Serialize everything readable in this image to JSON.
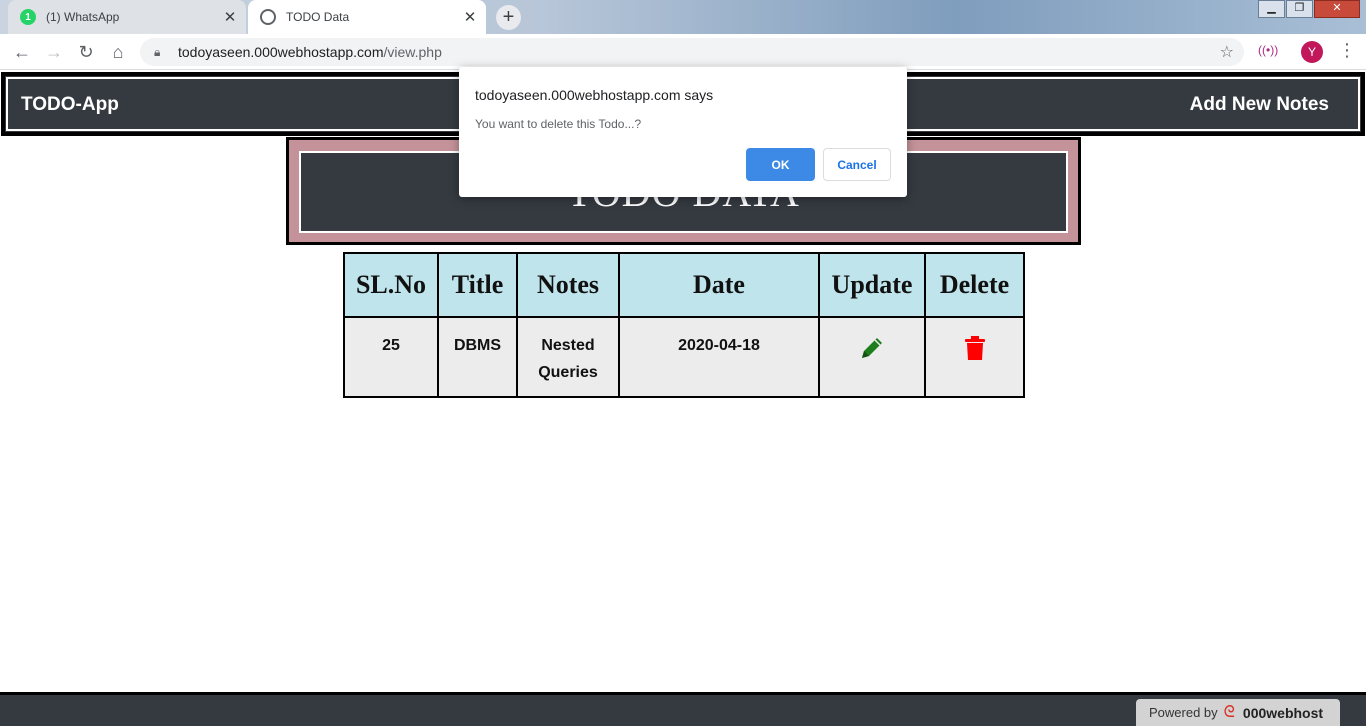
{
  "browser": {
    "tabs": [
      {
        "label": "(1) WhatsApp",
        "badge": "1",
        "icon": "whatsapp-icon",
        "active": false
      },
      {
        "label": "TODO Data",
        "icon": "globe-icon",
        "active": true
      }
    ],
    "url_host": "todoyaseen.000webhostapp.com",
    "url_path": "/view.php",
    "profile_initial": "Y"
  },
  "navbar": {
    "brand": "TODO-App",
    "add_link": "Add New Notes"
  },
  "page": {
    "heading": "TODO DATA"
  },
  "table": {
    "headers": [
      "SL.No",
      "Title",
      "Notes",
      "Date",
      "Update",
      "Delete"
    ],
    "rows": [
      {
        "sl": "25",
        "title": "DBMS",
        "notes_line1": "Nested",
        "notes_line2": "Queries",
        "date": "2020-04-18"
      }
    ]
  },
  "footer": {
    "powered_by": "Powered by",
    "host": "000webhost"
  },
  "dialog": {
    "origin": "todoyaseen.000webhostapp.com says",
    "message": "You want to delete this Todo...?",
    "ok_label": "OK",
    "cancel_label": "Cancel"
  },
  "colors": {
    "navbar": "#343a40",
    "header_frame": "#c4939a",
    "table_head": "#bfe4ec",
    "update_icon": "#1e7e1e",
    "delete_icon": "#ff0000",
    "ok_button": "#3c8ae5"
  }
}
